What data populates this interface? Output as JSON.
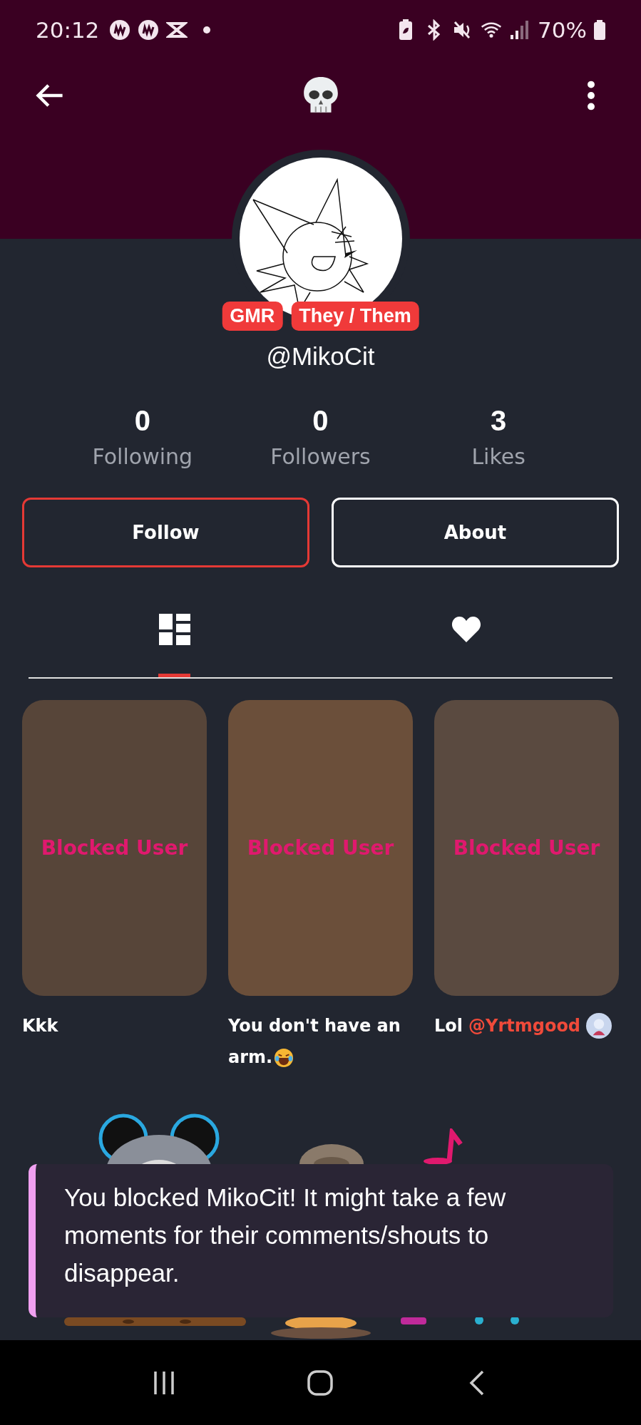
{
  "status_bar": {
    "time": "20:12",
    "battery": "70%"
  },
  "profile": {
    "badges": [
      "GMR",
      "They / Them"
    ],
    "username": "@MikoCit"
  },
  "stats": [
    {
      "value": "0",
      "label": "Following"
    },
    {
      "value": "0",
      "label": "Followers"
    },
    {
      "value": "3",
      "label": "Likes"
    }
  ],
  "buttons": [
    {
      "label": "Follow",
      "kind": "primary"
    },
    {
      "label": "About",
      "kind": "secondary"
    }
  ],
  "tabs": [
    {
      "kind": "grid",
      "selected": true
    },
    {
      "kind": "likes",
      "selected": false
    }
  ],
  "posts": [
    {
      "overlay": "Blocked User",
      "color": "#574539",
      "caption": "Kkk"
    },
    {
      "overlay": "Blocked User",
      "color": "#6b4f3a",
      "caption": "You don't have an arm.",
      "emoji": true
    },
    {
      "overlay": "Blocked User",
      "color": "#5a4a40",
      "caption": "Lol",
      "mention": "@Yrtmgood",
      "avatar": true
    }
  ],
  "toast": {
    "message": "You blocked MikoCit! It might take a few moments for their comments/shouts to disappear."
  }
}
